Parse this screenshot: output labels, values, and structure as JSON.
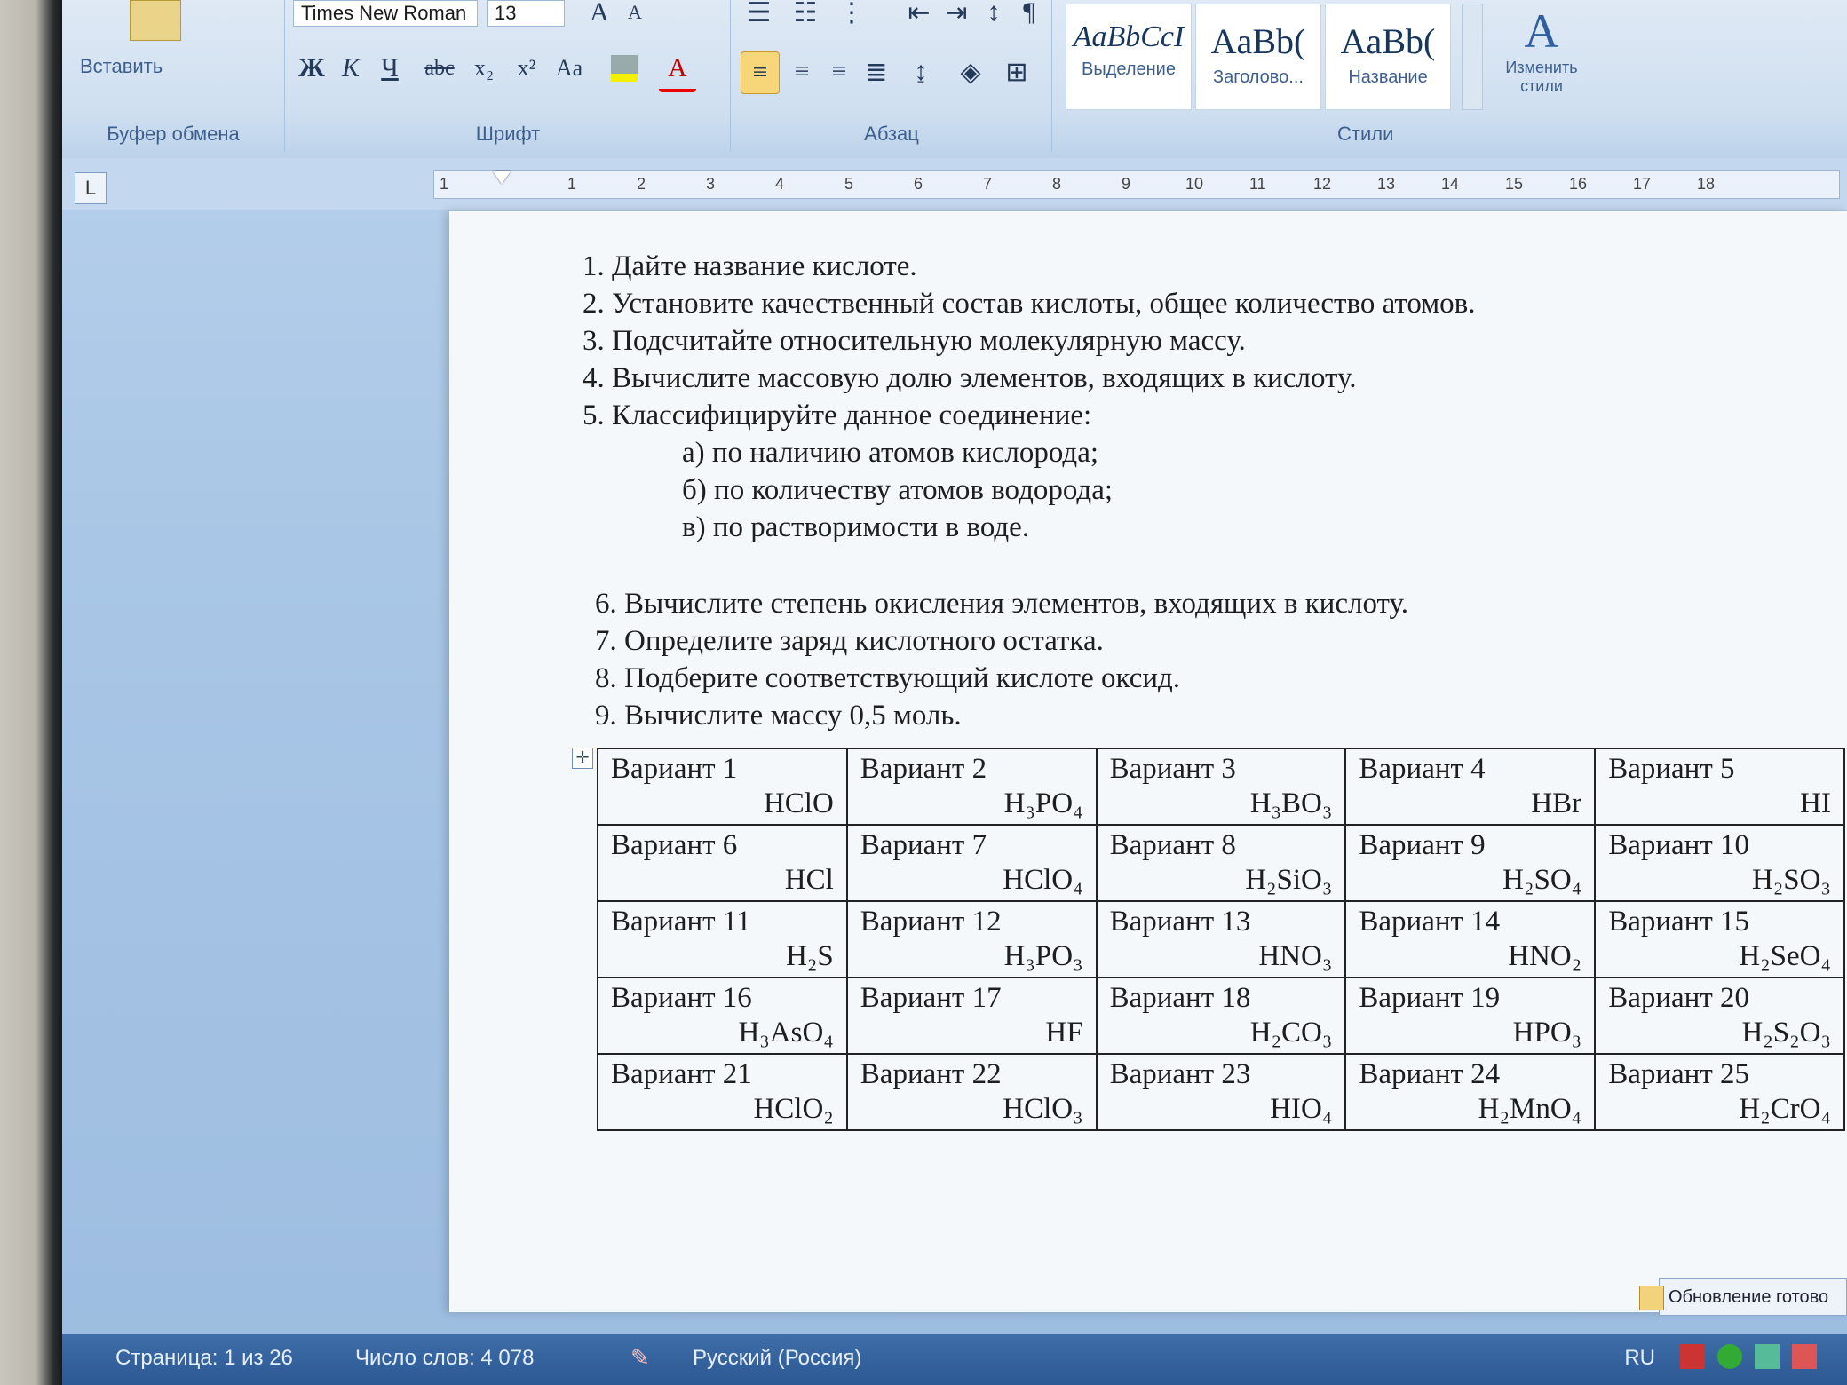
{
  "ribbon": {
    "clipboard": {
      "paste_label": "Вставить",
      "group_label": "Буфер обмена"
    },
    "font": {
      "family": "Times New Roman",
      "size": "13",
      "group_label": "Шрифт",
      "bold": "Ж",
      "italic": "К",
      "underline": "Ч",
      "strike": "abc",
      "subscript": "x₂",
      "superscript": "x²",
      "case": "Aa",
      "grow": "A",
      "shrink": "A",
      "color": "A"
    },
    "paragraph": {
      "group_label": "Абзац",
      "pilcrow": "¶"
    },
    "styles": {
      "group_label": "Стили",
      "tiles": [
        {
          "sample": "AaBbCcI",
          "name": "Выделение"
        },
        {
          "sample": "AaBb(",
          "name": "Заголово..."
        },
        {
          "sample": "AaBb(",
          "name": "Название"
        }
      ],
      "change_label": "Изменить стили"
    }
  },
  "ruler": {
    "tab_selector": "L",
    "marks": [
      "1",
      "1",
      "2",
      "3",
      "4",
      "5",
      "6",
      "7",
      "8",
      "9",
      "10",
      "11",
      "12",
      "13",
      "14",
      "15",
      "16",
      "17",
      "18"
    ]
  },
  "document": {
    "tasks": [
      "1. Дайте название кислоте.",
      "2. Установите качественный состав кислоты, общее количество атомов.",
      "3. Подсчитайте относительную молекулярную массу.",
      "4. Вычислите массовую долю элементов, входящих в кислоту.",
      "5. Классифицируйте данное соединение:"
    ],
    "subtasks": [
      "а) по наличию атомов кислорода;",
      "б) по количеству атомов водорода;",
      "в) по растворимости в воде."
    ],
    "tasks2": [
      "6. Вычислите степень окисления элементов, входящих в кислоту.",
      "7. Определите заряд кислотного остатка.",
      "8. Подберите соответствующий кислоте оксид.",
      "9. Вычислите массу 0,5 моль."
    ],
    "variants": [
      [
        {
          "name": "Вариант 1",
          "formula": "HClO"
        },
        {
          "name": "Вариант 2",
          "formula": "H₃PO₄"
        },
        {
          "name": "Вариант 3",
          "formula": "H₃BO₃"
        },
        {
          "name": "Вариант 4",
          "formula": "HBr"
        },
        {
          "name": "Вариант 5",
          "formula": "HI"
        }
      ],
      [
        {
          "name": "Вариант 6",
          "formula": "HCl"
        },
        {
          "name": "Вариант 7",
          "formula": "HClO₄"
        },
        {
          "name": "Вариант 8",
          "formula": "H₂SiO₃"
        },
        {
          "name": "Вариант 9",
          "formula": "H₂SO₄"
        },
        {
          "name": "Вариант 10",
          "formula": "H₂SO₃"
        }
      ],
      [
        {
          "name": "Вариант 11",
          "formula": "H₂S"
        },
        {
          "name": "Вариант 12",
          "formula": "H₃PO₃"
        },
        {
          "name": "Вариант 13",
          "formula": "HNO₃"
        },
        {
          "name": "Вариант 14",
          "formula": "HNO₂"
        },
        {
          "name": "Вариант 15",
          "formula": "H₂SeO₄"
        }
      ],
      [
        {
          "name": "Вариант 16",
          "formula": "H₃AsO₄"
        },
        {
          "name": "Вариант 17",
          "formula": "HF"
        },
        {
          "name": "Вариант 18",
          "formula": "H₂CO₃"
        },
        {
          "name": "Вариант 19",
          "formula": "HPO₃"
        },
        {
          "name": "Вариант 20",
          "formula": "H₂S₂O₃"
        }
      ],
      [
        {
          "name": "Вариант 21",
          "formula": "HClO₂"
        },
        {
          "name": "Вариант 22",
          "formula": "HClO₃"
        },
        {
          "name": "Вариант 23",
          "formula": "HIO₄"
        },
        {
          "name": "Вариант 24",
          "formula": "H₂MnO₄"
        },
        {
          "name": "Вариант 25",
          "formula": "H₂CrO₄"
        }
      ]
    ]
  },
  "statusbar": {
    "page_info": "Страница: 1 из 26",
    "word_count": "Число слов: 4 078",
    "language": "Русский (Россия)"
  },
  "tray": {
    "lang": "RU",
    "update_tip": "Обновление готово"
  },
  "colors": {
    "ribbon": "#cfdff0",
    "page": "#f5f8fb",
    "status": "#2c5893"
  }
}
